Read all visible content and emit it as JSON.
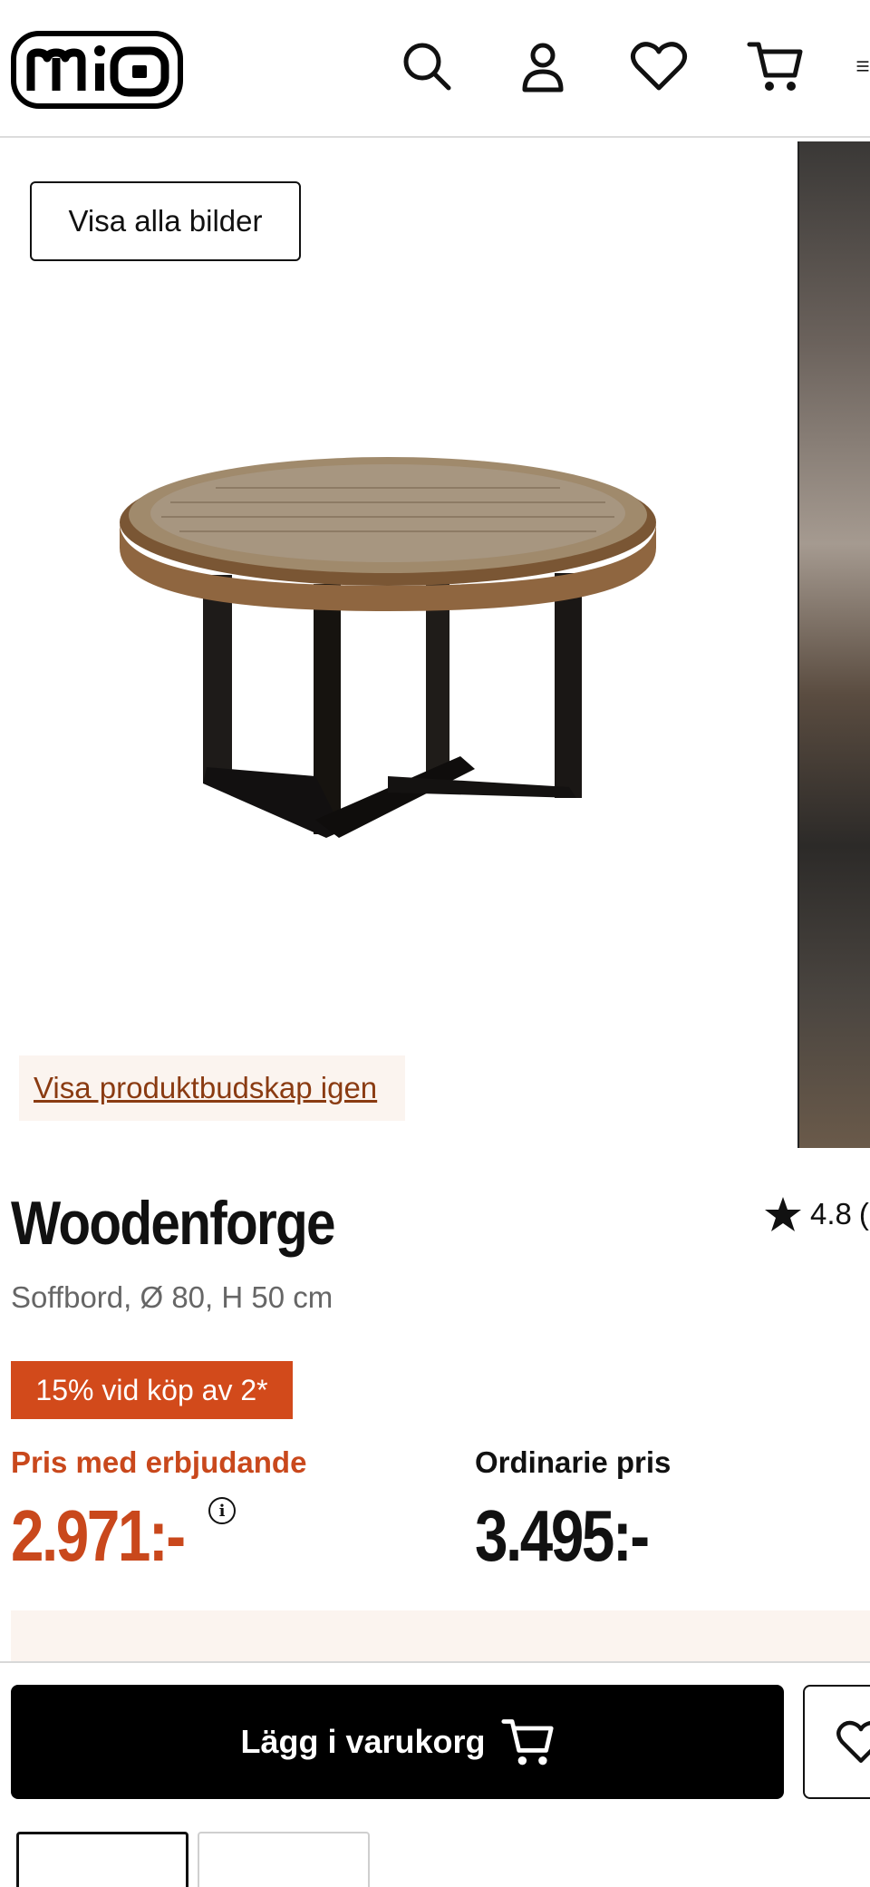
{
  "header": {
    "logo_text": "mio",
    "icons": [
      "search-icon",
      "user-icon",
      "heart-icon",
      "cart-icon",
      "menu-icon"
    ]
  },
  "gallery": {
    "show_all_label": "Visa alla bilder",
    "show_message_label": "Visa produktbudskap igen"
  },
  "product": {
    "name": "Woodenforge",
    "rating": "4.8",
    "rating_suffix": "(",
    "subtitle": "Soffbord, Ø 80, H 50 cm",
    "promo_badge": "15% vid köp av 2*",
    "offer_label": "Pris med erbjudande",
    "offer_price": "2.971:-",
    "regular_label": "Ordinarie pris",
    "regular_price": "3.495:-",
    "info_symbol": "i"
  },
  "sticky_bar": {
    "add_to_cart_label": "Lägg i varukorg"
  },
  "colors": {
    "accent": "#c9481c",
    "badge_bg": "#d24a1b",
    "soft_bg": "#fbf4ef",
    "text": "#111111"
  }
}
